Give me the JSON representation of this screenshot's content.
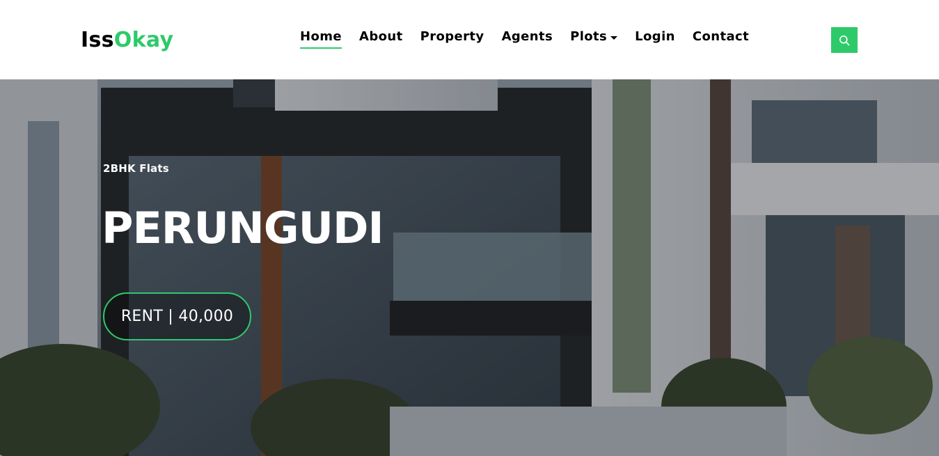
{
  "brand": {
    "part1": "Iss",
    "part2": "Okay"
  },
  "nav": {
    "items": [
      {
        "label": "Home"
      },
      {
        "label": "About"
      },
      {
        "label": "Property"
      },
      {
        "label": "Agents"
      },
      {
        "label": "Plots"
      },
      {
        "label": "Login"
      },
      {
        "label": "Contact"
      }
    ]
  },
  "search_icon": "search-icon",
  "hero": {
    "subtitle": "2BHK Flats",
    "title": "PERUNGUDI",
    "price_label": "RENT | 40,000"
  },
  "colors": {
    "accent": "#2eca6a",
    "text": "#000000",
    "hero_text": "#ffffff"
  }
}
